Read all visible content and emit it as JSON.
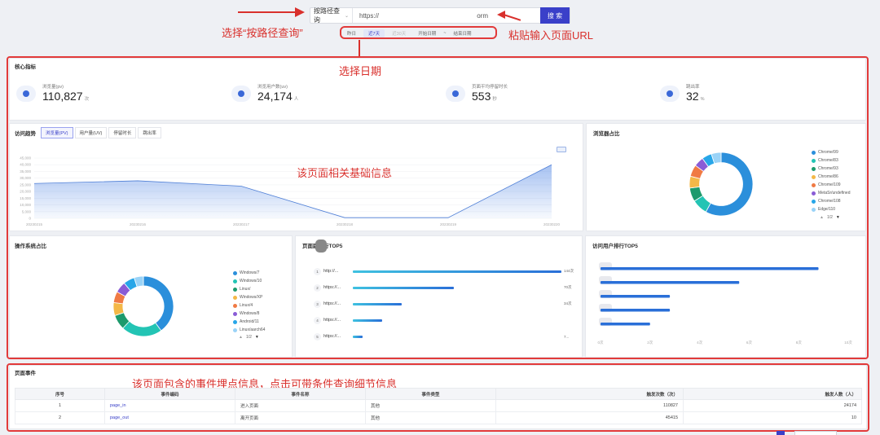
{
  "search": {
    "mode_label": "按路径查询",
    "url_value": "https://",
    "url_tail": "orm",
    "button_label": "搜 索"
  },
  "date_filter": {
    "items": [
      "昨日",
      "近7天",
      "近30天",
      "开始日期",
      "~",
      "结束日期"
    ],
    "active_index": 1
  },
  "annotations": {
    "select_mode": "选择“按路径查询”",
    "paste_url": "粘贴输入页面URL",
    "select_date": "选择日期",
    "basic_info": "该页面相关基础信息",
    "events_info": "该页面包含的事件埋点信息，点击可带条件查询细节信息"
  },
  "core_metrics": {
    "title": "核心指标",
    "items": [
      {
        "label": "浏览量(pv)",
        "value": "110,827",
        "unit": "次"
      },
      {
        "label": "浏览用户数(uv)",
        "value": "24,174",
        "unit": "人"
      },
      {
        "label": "页面平均停留时长",
        "value": "553",
        "unit": "秒"
      },
      {
        "label": "跳出率",
        "value": "32",
        "unit": "%"
      }
    ]
  },
  "trend": {
    "title": "访问趋势",
    "tabs": [
      "浏览量(PV)",
      "用户量(UV)",
      "停留时长",
      "跳出率"
    ],
    "active_tab": 0
  },
  "chart_data": [
    {
      "type": "area",
      "title": "访问趋势",
      "series": [
        {
          "name": "浏览量(PV)",
          "values": [
            26000,
            28000,
            24000,
            500,
            500,
            40000
          ]
        }
      ],
      "x": [
        "20230215",
        "20230216",
        "20230217",
        "20230218",
        "20230219",
        "20230220"
      ],
      "y_ticks": [
        "45,000",
        "40,000",
        "35,000",
        "30,000",
        "25,000",
        "20,000",
        "15,000",
        "10,000",
        "5,000",
        "0"
      ],
      "ylim": [
        0,
        45000
      ]
    },
    {
      "type": "pie",
      "title": "浏览器占比",
      "labels": [
        "Chrome/99",
        "Chrome/83",
        "Chrome/93",
        "Chrome/86",
        "Chrome/109",
        "MetaSr/undefined",
        "Chrome/108",
        "Edge/110"
      ],
      "values": [
        58,
        8,
        7,
        6,
        6,
        5,
        5,
        5
      ],
      "pager": "1/2"
    },
    {
      "type": "pie",
      "title": "操作系统占比",
      "labels": [
        "Windows/7",
        "Windows/10",
        "Linux/",
        "Windows/XP",
        "Linux/4",
        "Windows/8",
        "Android/11",
        "Linux/aarch64"
      ],
      "values": [
        40,
        22,
        8,
        7,
        6,
        6,
        6,
        5
      ],
      "pager": "1/2"
    },
    {
      "type": "bar",
      "title": "页面跳转行TOP5",
      "categories": [
        "http://...",
        "https://...",
        "https://...",
        "https://...",
        "https://..."
      ],
      "values": [
        144,
        70,
        34,
        20,
        7
      ],
      "value_labels": [
        "144次",
        "70次",
        "34次",
        "",
        "7..."
      ]
    },
    {
      "type": "bar",
      "title": "访问用户排行TOP5",
      "values": [
        110,
        70,
        35,
        35,
        25
      ],
      "x_ticks": [
        "0次",
        "2次",
        "4次",
        "6次",
        "8次",
        "10次"
      ]
    }
  ],
  "panels": {
    "browser_title": "浏览器占比",
    "os_title": "操作系统占比",
    "page_title": "页面跳转行TOP5",
    "user_title": "访问用户排行TOP5"
  },
  "events": {
    "title": "页面事件",
    "columns": [
      "序号",
      "事件编码",
      "事件名称",
      "事件类型",
      "触发次数（次）",
      "触发人数（人）"
    ],
    "rows": [
      [
        "1",
        "page_in",
        "进入页面",
        "其他",
        "110827",
        "24174"
      ],
      [
        "2",
        "page_out",
        "离开页面",
        "其他",
        "45415",
        "10"
      ]
    ]
  },
  "colors": {
    "primary": "#3a40c9",
    "annotation_red": "#d9302c",
    "palette": [
      "#2b8fdb",
      "#23c4b4",
      "#1d9a6c",
      "#f4b847",
      "#f07a44",
      "#8a5cd6",
      "#27a6e8",
      "#9ad3f7"
    ]
  }
}
